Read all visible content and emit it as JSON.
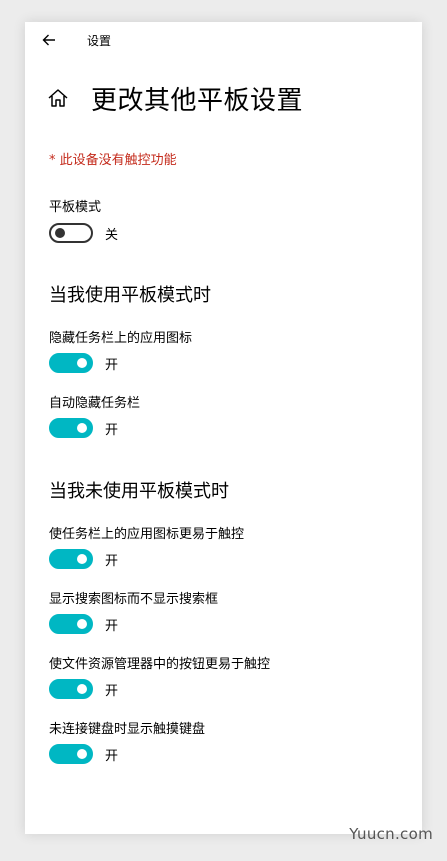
{
  "window": {
    "title": "设置"
  },
  "page": {
    "title": "更改其他平板设置"
  },
  "warning": "* 此设备没有触控功能",
  "tablet_mode": {
    "label": "平板模式",
    "state": "关"
  },
  "section_on": {
    "heading": "当我使用平板模式时",
    "settings": [
      {
        "label": "隐藏任务栏上的应用图标",
        "state": "开"
      },
      {
        "label": "自动隐藏任务栏",
        "state": "开"
      }
    ]
  },
  "section_off": {
    "heading": "当我未使用平板模式时",
    "settings": [
      {
        "label": "使任务栏上的应用图标更易于触控",
        "state": "开"
      },
      {
        "label": "显示搜索图标而不显示搜索框",
        "state": "开"
      },
      {
        "label": "使文件资源管理器中的按钮更易于触控",
        "state": "开"
      },
      {
        "label": "未连接键盘时显示触摸键盘",
        "state": "开"
      }
    ]
  },
  "watermark": "Yuucn.com",
  "colors": {
    "accent": "#00b7c3",
    "warning": "#c42b1c"
  },
  "icons": {
    "back": "back-arrow-icon",
    "home": "home-icon"
  }
}
